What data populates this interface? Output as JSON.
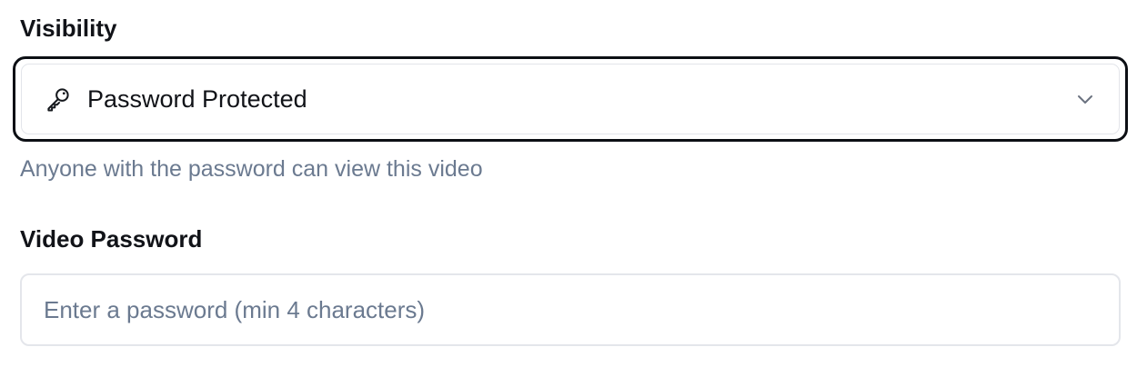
{
  "visibility": {
    "label": "Visibility",
    "selected_value": "Password Protected",
    "selected_icon": "key-icon",
    "dropdown_icon": "chevron-down-icon",
    "help_text": "Anyone with the password can view this video"
  },
  "video_password": {
    "label": "Video Password",
    "value": "",
    "placeholder": "Enter a password (min 4 characters)"
  }
}
